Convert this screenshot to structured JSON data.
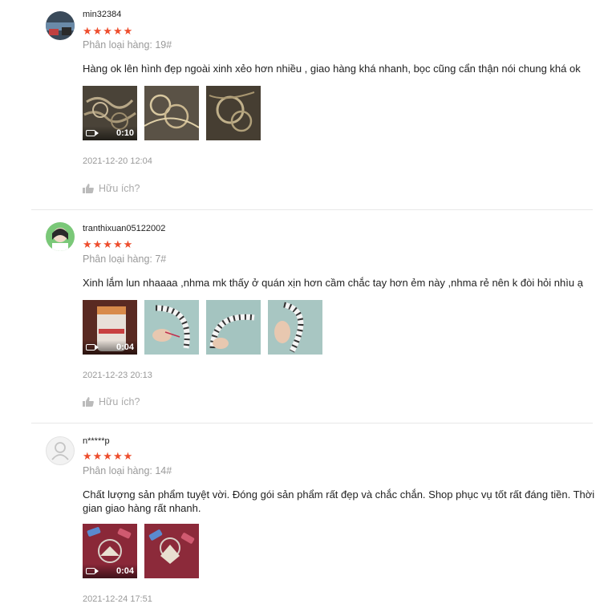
{
  "reviews": [
    {
      "username": "min32384",
      "stars": "★★★★★",
      "variation": "Phân loại hàng: 19#",
      "comment": "Hàng ok lên hình đẹp ngoài xinh xẻo hơn nhiều , giao hàng khá nhanh, bọc cũng cẩn thận nói chung khá ok",
      "video_duration": "0:10",
      "date": "2021-12-20 12:04",
      "helpful": "Hữu ích?"
    },
    {
      "username": "tranthixuan05122002",
      "stars": "★★★★★",
      "variation": "Phân loại hàng: 7#",
      "comment": "Xinh lắm lun nhaaaa ,nhma mk thấy ở quán xịn hơn cầm chắc tay hơn ẻm này ,nhma rẻ nên k đòi hỏi nhìu ạ",
      "video_duration": "0:04",
      "date": "2021-12-23 20:13",
      "helpful": "Hữu ích?"
    },
    {
      "username": "n*****p",
      "stars": "★★★★★",
      "variation": "Phân loại hàng: 14#",
      "comment": "Chất lượng sản phẩm tuyệt vời. Đóng gói sản phẩm rất đẹp và chắc chắn. Shop phục vụ tốt rất đáng tiền. Thời gian giao hàng rất nhanh.",
      "video_duration": "0:04",
      "date": "2021-12-24 17:51"
    }
  ],
  "colors": {
    "star": "#ee4d2d",
    "muted": "#999999",
    "divider": "#e8e8e8"
  }
}
